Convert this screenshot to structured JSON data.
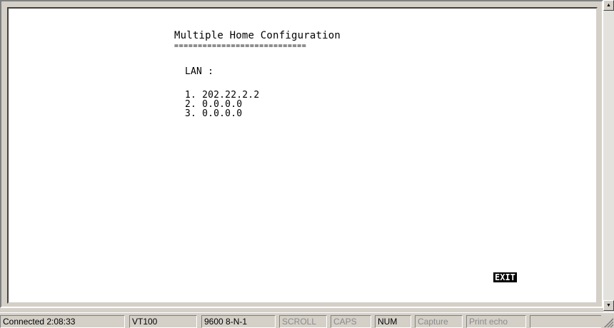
{
  "terminal": {
    "title": "Multiple Home Configuration",
    "underline": "============================",
    "lan_label": "LAN :",
    "entries": [
      "1. 202.22.2.2",
      "2. 0.0.0.0",
      "3. 0.0.0.0"
    ],
    "exit_label": "EXIT"
  },
  "status_bar": {
    "connection": "Connected 2:08:33",
    "emulation": "VT100",
    "port_settings": "9600 8-N-1",
    "scroll": "SCROLL",
    "caps": "CAPS",
    "num": "NUM",
    "capture": "Capture",
    "print_echo": "Print echo"
  },
  "icons": {
    "scroll_up": "scroll-up-arrow-icon",
    "scroll_down": "scroll-down-arrow-icon",
    "resize_grip": "resize-grip-icon"
  }
}
